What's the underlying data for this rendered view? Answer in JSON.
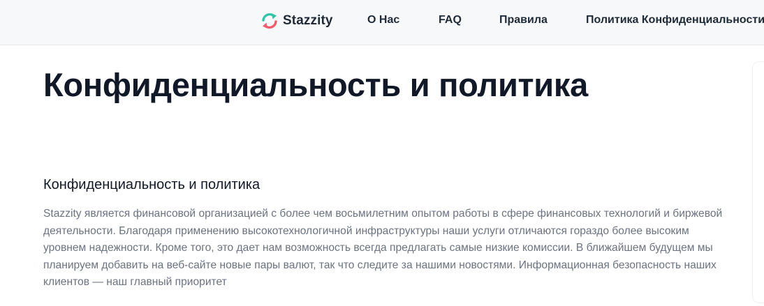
{
  "header": {
    "brand_name": "Stazzity",
    "nav": [
      "О Нас",
      "FAQ",
      "Правила",
      "Политика Конфиденциальности"
    ]
  },
  "main": {
    "page_title": "Конфиденциальность и политика",
    "section_title": "Конфиденциальность и политика",
    "body_text": "Stazzity является финансовой организацией с более чем восьмилетним опытом работы в сфере финансовых технологий и биржевой деятельности. Благодаря применению высокотехнологичной инфраструктуры наши услуги отличаются гораздо более высоким уровнем надежности. Кроме того, это дает нам возможность всегда предлагать самые низкие комиссии. В ближайшем будущем мы планируем добавить на веб-сайте новые пары валют, так что следите за нашими новостями. Информационная безопасность наших клиентов — наш главный приоритет"
  },
  "colors": {
    "logo_green": "#2ec4a6",
    "logo_red": "#f25c6a",
    "header_bg": "#f7f8fa",
    "text_dark": "#111827",
    "text_muted": "#6b7280"
  },
  "icons": {
    "logo": "exchange-arrows-icon"
  }
}
